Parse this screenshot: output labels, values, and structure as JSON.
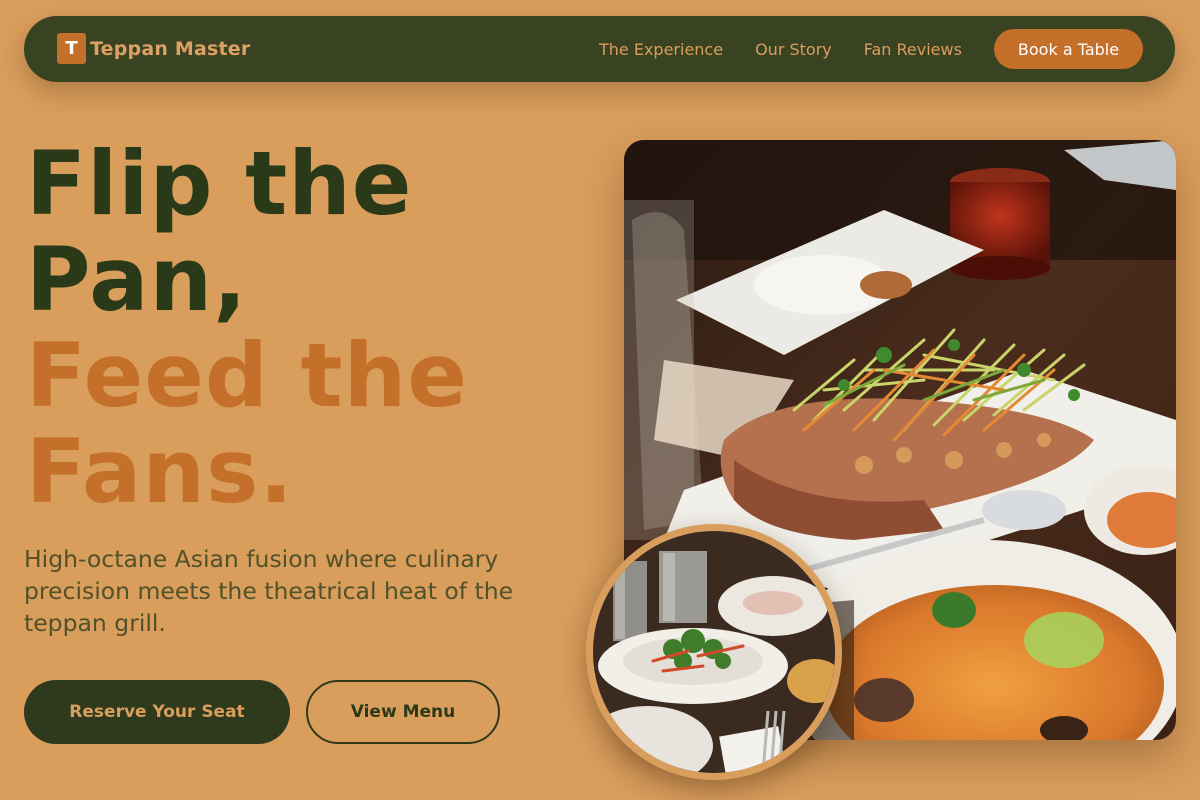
{
  "nav": {
    "logo_letter": "T",
    "brand_name": "Teppan Master",
    "links": [
      "The Experience",
      "Our Story",
      "Fan Reviews"
    ],
    "cta": "Book a Table"
  },
  "hero": {
    "headline_dark": [
      "Flip the",
      "Pan,"
    ],
    "headline_accent": [
      "Feed the",
      "Fans."
    ],
    "subtitle": "High-octane Asian fusion where culinary precision meets the theatrical heat of the teppan grill.",
    "primary_button": "Reserve Your Seat",
    "secondary_button": "View Menu"
  },
  "images": {
    "main": "whole fried fish with shredded papaya salad, curry bowl and side dishes on a wooden table",
    "inset": "table with plates of fresh salad and metal cups"
  },
  "colors": {
    "background": "#d99d5c",
    "nav_bg": "#3a4321",
    "accent": "#c46f2a",
    "dark_text": "#2a3a18"
  }
}
